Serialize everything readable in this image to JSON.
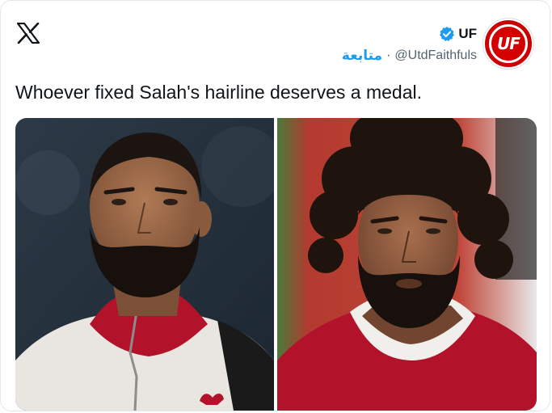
{
  "brand": {
    "logo_icon": "x-logo-icon"
  },
  "author": {
    "display_name": "UF",
    "handle": "@UtdFaithfuls",
    "separator": "·",
    "follow_label": "متابعة",
    "verified_icon": "verified-badge-icon",
    "avatar_text": "UF",
    "avatar_color": "#cc0000"
  },
  "tweet": {
    "text": "Whoever fixed Salah's hairline deserves a medal."
  },
  "media": {
    "images": [
      {
        "name": "salah-short-hair-photo"
      },
      {
        "name": "salah-curly-hair-photo"
      }
    ]
  },
  "colors": {
    "accent": "#1d9bf0",
    "text": "#0f1419",
    "secondary_text": "#536471",
    "liverpool_red": "#b3132a"
  }
}
